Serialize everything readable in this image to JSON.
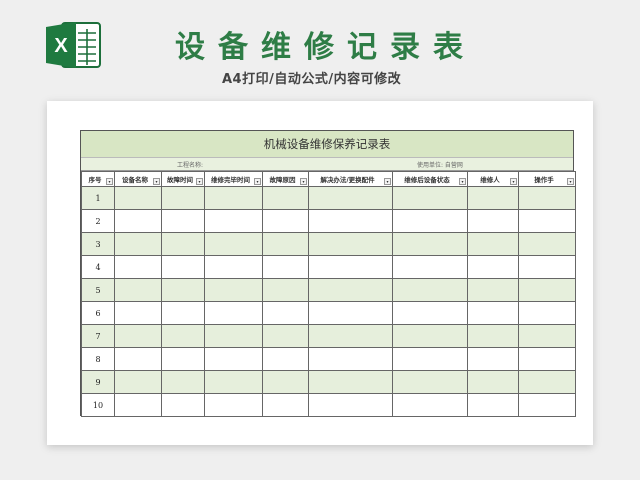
{
  "header": {
    "title": "设备维修记录表",
    "subtitle": "A4打印/自动公式/内容可修改",
    "logo_letter": "X"
  },
  "sheet": {
    "title": "机械设备维修保养记录表",
    "project_label": "工程名称:",
    "unit_label": "使用单位: 自营网",
    "columns": [
      "序号",
      "设备名称",
      "故障时间",
      "维修完毕时间",
      "故障原因",
      "解决办法/更换配件",
      "维修后设备状态",
      "维修人",
      "操作手"
    ],
    "rows": [
      "1",
      "2",
      "3",
      "4",
      "5",
      "6",
      "7",
      "8",
      "9",
      "10"
    ]
  },
  "colors": {
    "brand_green": "#2e7d46",
    "title_band": "#d8e6c4",
    "alt_row": "#e6efdc"
  },
  "icons": [
    "excel-logo-icon",
    "filter-dropdown-icon"
  ]
}
